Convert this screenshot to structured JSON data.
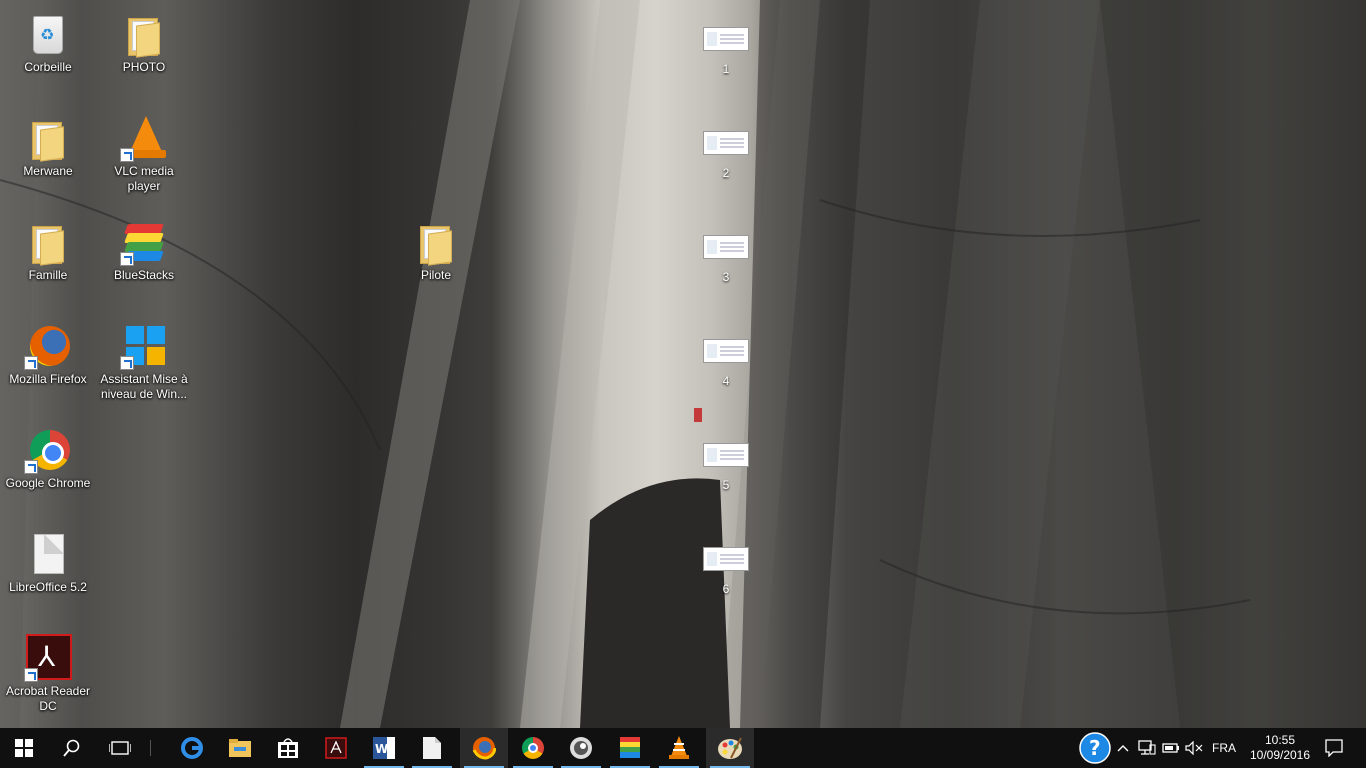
{
  "desktop": {
    "icons": [
      {
        "label": "Corbeille",
        "icon": "recycle-bin-icon"
      },
      {
        "label": "PHOTO",
        "icon": "folder-icon"
      },
      {
        "label": "Merwane",
        "icon": "folder-icon"
      },
      {
        "label": "VLC media player",
        "icon": "vlc-icon"
      },
      {
        "label": "Famille",
        "icon": "folder-icon"
      },
      {
        "label": "BlueStacks",
        "icon": "bluestacks-icon"
      },
      {
        "label": "Pilote",
        "icon": "folder-icon"
      },
      {
        "label": "Mozilla Firefox",
        "icon": "firefox-icon"
      },
      {
        "label": "Assistant Mise à niveau de Win...",
        "icon": "windows-logo-icon"
      },
      {
        "label": "Google Chrome",
        "icon": "chrome-icon"
      },
      {
        "label": "LibreOffice 5.2",
        "icon": "document-icon"
      },
      {
        "label": "Acrobat Reader DC",
        "icon": "acrobat-icon"
      }
    ],
    "window_thumbs": [
      "1",
      "2",
      "3",
      "4",
      "5",
      "6"
    ]
  },
  "taskbar": {
    "apps": [
      {
        "icon": "start-windows-icon"
      },
      {
        "icon": "search-icon"
      },
      {
        "icon": "task-view-icon"
      },
      {
        "icon": "edge-icon"
      },
      {
        "icon": "file-explorer-icon"
      },
      {
        "icon": "store-icon"
      },
      {
        "icon": "acrobat-icon"
      },
      {
        "icon": "word-icon"
      },
      {
        "icon": "blank-document-icon"
      },
      {
        "icon": "firefox-icon"
      },
      {
        "icon": "chrome-icon"
      },
      {
        "icon": "eye-app-icon"
      },
      {
        "icon": "bluestacks-icon"
      },
      {
        "icon": "vlc-icon"
      },
      {
        "icon": "paint-palette-icon"
      }
    ],
    "tray": {
      "language": "FRA",
      "time": "10:55",
      "date": "10/09/2016"
    }
  },
  "colors": {
    "taskbar_bg": "#101010",
    "accent": "#76b9ed"
  }
}
